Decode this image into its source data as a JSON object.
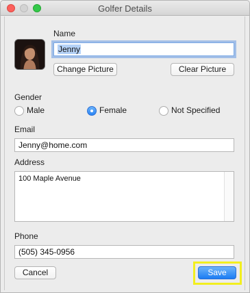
{
  "window": {
    "title": "Golfer Details"
  },
  "labels": {
    "name": "Name",
    "gender": "Gender",
    "email": "Email",
    "address": "Address",
    "phone": "Phone"
  },
  "fields": {
    "name_value": "Jenny",
    "email_value": "Jenny@home.com",
    "address_value": "100 Maple Avenue",
    "phone_value": "(505) 345-0956"
  },
  "buttons": {
    "change_picture": "Change Picture",
    "clear_picture": "Clear Picture",
    "cancel": "Cancel",
    "save": "Save"
  },
  "gender": {
    "options": [
      "Male",
      "Female",
      "Not Specified"
    ],
    "selected": "Female"
  },
  "colors": {
    "accent": "#1b7cf3",
    "highlight": "#f2ef1f",
    "close": "#fc605c",
    "maximize": "#34c84a"
  }
}
